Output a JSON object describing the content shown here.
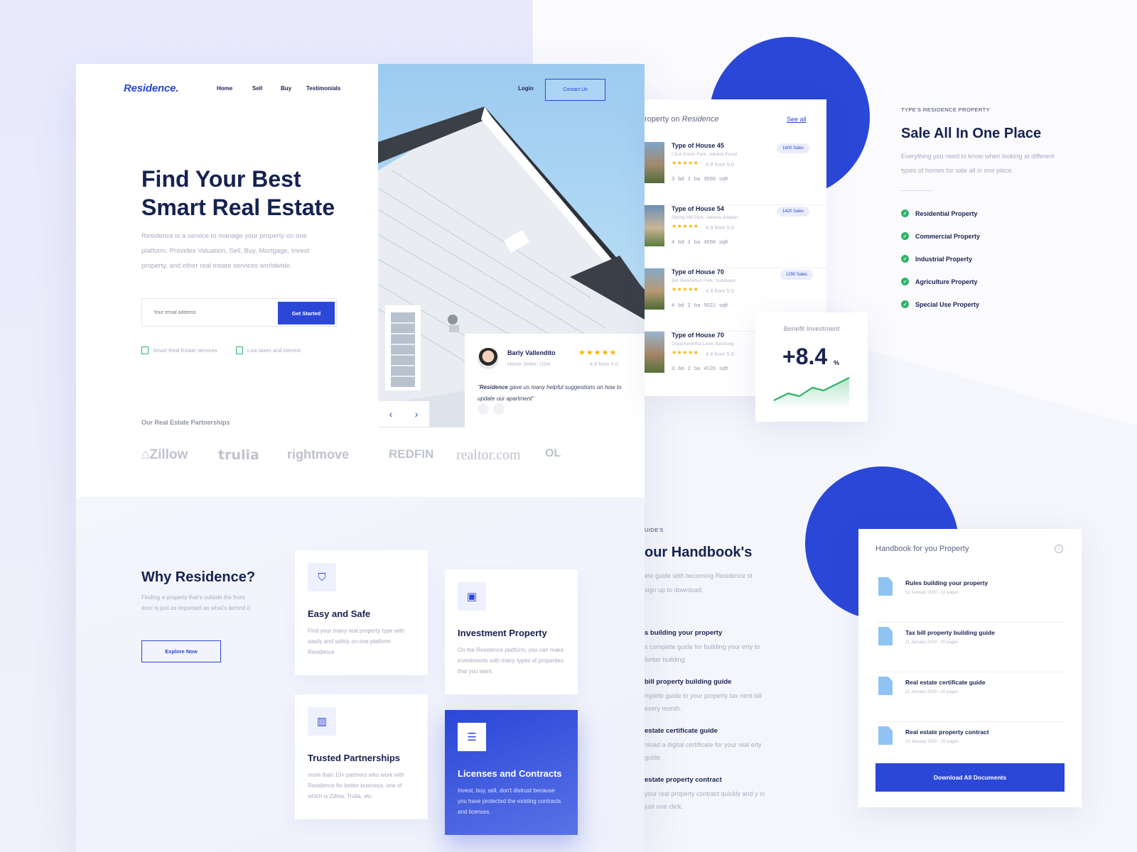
{
  "landing": {
    "logo": "Residence.",
    "nav": [
      "Home",
      "Sell",
      "Buy",
      "Testimonials"
    ],
    "login": "Login",
    "contact": "Contact Us",
    "hero_title_line1": "Find Your Best",
    "hero_title_line2": "Smart Real Estate",
    "hero_desc": "Residence is a service to manage your property on one platform. Provides Valuation, Sell, Buy, Mortgage, Invest property, and other real estate services worldwide.",
    "email_placeholder": "Your email address",
    "get_started": "Get Started",
    "feature1": "Smart Real Estate services",
    "feature2": "Low taxes and interest",
    "partners_label": "Our Real Estate Partnerships",
    "partners": [
      "Zillow",
      "trulia",
      "rightmove",
      "REDFIN",
      "realtor.com",
      "OL"
    ],
    "testimonial": {
      "name": "Barly Vallendito",
      "role": "Home Seller, USA",
      "stars": "★★★★★",
      "score": "4.9 from 5.0",
      "quote_brand": "Residence",
      "quote_rest": " gave us many helpful suggestions on how to update our apartment\"",
      "quote_open": "\""
    },
    "arrow_prev": "‹",
    "arrow_next": "›"
  },
  "why": {
    "title": "Why Residence?",
    "desc": "Finding a property that's outside the front door is just as important as what's behind it.",
    "explore": "Explore Now",
    "cards": [
      {
        "title": "Easy and Safe",
        "desc": "Find your many real property type with easily and safely on one platform Residence",
        "icon": "shield-icon"
      },
      {
        "title": "Investment Property",
        "desc": "On the Residence platform, you can make investments with many types of properties that you want.",
        "icon": "money-icon"
      },
      {
        "title": "Trusted Partnerships",
        "desc": "more than 10+ partners who work with Residence for better business, one of which is Zillow, Trulia, etc.",
        "icon": "building-icon"
      },
      {
        "title": "Licenses and Contracts",
        "desc": "Invest, buy, sell, don't distrust because you have protected the existing contracts and licenses.",
        "icon": "document-icon"
      }
    ]
  },
  "property_list": {
    "title_prefix": "roperty on ",
    "title_brand": "Residence",
    "see_all": "See all",
    "items": [
      {
        "name": "Type of House 45",
        "location": "Citra Green Park, Jakarta Pusat",
        "stars": "★★★★★",
        "score": "4.9 from 5.0",
        "specs": "3 bd   2 ba   3556 sqft",
        "badge": "1600 Sales"
      },
      {
        "name": "Type of House 54",
        "location": "Spring Hill Park, Jakarta Selatan",
        "stars": "★★★★★",
        "score": "4.9 from 5.0",
        "specs": "4 bd   2 ba   4556 sqft",
        "badge": "1420 Sales"
      },
      {
        "name": "Type of House 70",
        "location": "Ijen Residence Park, Surabaya",
        "stars": "★★★★★",
        "score": "4.8 from 5.0",
        "specs": "4 bd   2 ba   5021 sqft",
        "badge": "1290 Sales"
      },
      {
        "name": "Type of House 70",
        "location": "Griya Amartha Land, Bandung",
        "stars": "★★★★★",
        "score": "4.8 from 5.0",
        "specs": "3 bd   2 ba   4120 sqft",
        "badge": ""
      }
    ]
  },
  "benefit": {
    "label": "Benefit Investment",
    "value": "+8.4",
    "unit": "%"
  },
  "types": {
    "tag": "TYPE'S RESIDENCE PROPERTY",
    "title": "Sale All In One Place",
    "desc": "Everything you need to know when looking at different types of homes for sale all in one place.",
    "items": [
      "Residential Property",
      "Commercial Property",
      "Industrial Property",
      "Agriculture Property",
      "Special Use Property"
    ]
  },
  "guide": {
    "tag": "UIDE'S",
    "title": "our Handbook's",
    "desc": "ete guide with becoming Residence st sign up to download.",
    "items": [
      {
        "title": "s building your property",
        "desc": "s complete guide for building your erty to better building."
      },
      {
        "title": "bill property building guide",
        "desc": "mplete guide to your property tax nent bill every month."
      },
      {
        "title": "estate certificate guide",
        "desc": "nload a digital certificate for your real erty guide."
      },
      {
        "title": "estate property contract",
        "desc": "your real property contract quickly and y in just one click."
      }
    ]
  },
  "handbook": {
    "title": "Handbook for you Property",
    "info": "i",
    "docs": [
      {
        "name": "Rules building your property",
        "meta": "12 January 2020 - 12 pages"
      },
      {
        "name": "Tax bill property building guide",
        "meta": "11 January 2020 - 20 pages"
      },
      {
        "name": "Real estate certificate guide",
        "meta": "11 January 2020 - 10 pages"
      },
      {
        "name": "Real estate property contract",
        "meta": "10 January 2020 - 20 pages"
      }
    ],
    "download": "Download All Documents"
  },
  "colors": {
    "accent": "#2a47d8",
    "success": "#2fb36a",
    "star": "#f5b400"
  }
}
